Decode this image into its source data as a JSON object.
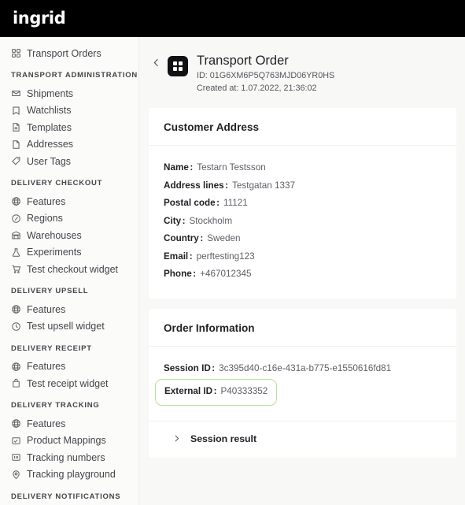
{
  "brand": {
    "logo_text": "ingrid"
  },
  "sidebar": {
    "top_item": {
      "label": "Transport Orders",
      "icon": "grid-icon"
    },
    "sections": [
      {
        "label": "TRANSPORT ADMINISTRATION",
        "items": [
          {
            "label": "Shipments",
            "icon": "inbox-icon"
          },
          {
            "label": "Watchlists",
            "icon": "bookmark-icon"
          },
          {
            "label": "Templates",
            "icon": "document-icon"
          },
          {
            "label": "Addresses",
            "icon": "page-icon"
          },
          {
            "label": "User Tags",
            "icon": "tag-icon"
          }
        ]
      },
      {
        "label": "DELIVERY CHECKOUT",
        "items": [
          {
            "label": "Features",
            "icon": "globe-icon"
          },
          {
            "label": "Regions",
            "icon": "compass-icon"
          },
          {
            "label": "Warehouses",
            "icon": "warehouse-icon"
          },
          {
            "label": "Experiments",
            "icon": "flask-icon"
          },
          {
            "label": "Test checkout widget",
            "icon": "cart-icon"
          }
        ]
      },
      {
        "label": "DELIVERY UPSELL",
        "items": [
          {
            "label": "Features",
            "icon": "globe-icon"
          },
          {
            "label": "Test upsell widget",
            "icon": "clock-icon"
          }
        ]
      },
      {
        "label": "DELIVERY RECEIPT",
        "items": [
          {
            "label": "Features",
            "icon": "globe-icon"
          },
          {
            "label": "Test receipt widget",
            "icon": "bag-icon"
          }
        ]
      },
      {
        "label": "DELIVERY TRACKING",
        "items": [
          {
            "label": "Features",
            "icon": "globe-icon"
          },
          {
            "label": "Product Mappings",
            "icon": "mapping-icon"
          },
          {
            "label": "Tracking numbers",
            "icon": "number-icon"
          },
          {
            "label": "Tracking playground",
            "icon": "pin-icon"
          }
        ]
      },
      {
        "label": "DELIVERY NOTIFICATIONS",
        "items": []
      }
    ]
  },
  "header": {
    "back_icon": "chevron-left-icon",
    "page_icon": "grid-icon",
    "title": "Transport Order",
    "id_line": "ID: 01G6XM6P5Q763MJD06YR0HS",
    "created_line": "Created at: 1.07.2022, 21:36:02"
  },
  "customer_address": {
    "title": "Customer Address",
    "fields": [
      {
        "label": "Name",
        "value": "Testarn Testsson"
      },
      {
        "label": "Address lines",
        "value": "Testgatan 1337"
      },
      {
        "label": "Postal code",
        "value": "11121"
      },
      {
        "label": "City",
        "value": "Stockholm"
      },
      {
        "label": "Country",
        "value": "Sweden"
      },
      {
        "label": "Email",
        "value": "perftesting123"
      },
      {
        "label": "Phone",
        "value": "+467012345"
      }
    ]
  },
  "order_information": {
    "title": "Order Information",
    "session_id": {
      "label": "Session ID",
      "value": "3c395d40-c16e-431a-b775-e1550616fd81"
    },
    "external_id": {
      "label": "External ID",
      "value": "P40333352"
    },
    "accordion": {
      "label": "Session result",
      "icon": "chevron-right-icon"
    }
  },
  "colors": {
    "topbar_bg": "#000000",
    "sidebar_bg": "#fbfbfa",
    "main_bg": "#f8f8f7",
    "card_bg": "#ffffff",
    "highlight_border": "#b8dfa0",
    "label_text": "#1f2024",
    "value_text": "#5d5f65"
  }
}
